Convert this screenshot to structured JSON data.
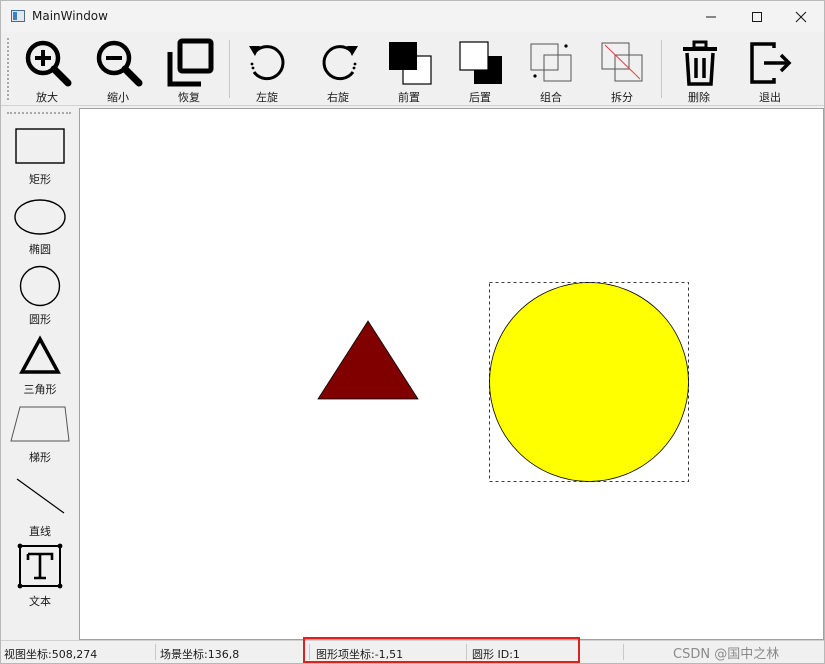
{
  "window": {
    "title": "MainWindow"
  },
  "toolbar": {
    "items": [
      {
        "label": "放大"
      },
      {
        "label": "缩小"
      },
      {
        "label": "恢复"
      },
      {
        "label": "左旋"
      },
      {
        "label": "右旋"
      },
      {
        "label": "前置"
      },
      {
        "label": "后置"
      },
      {
        "label": "组合"
      },
      {
        "label": "拆分"
      },
      {
        "label": "删除"
      },
      {
        "label": "退出"
      }
    ]
  },
  "sidebar": {
    "items": [
      {
        "label": "矩形"
      },
      {
        "label": "椭圆"
      },
      {
        "label": "圆形"
      },
      {
        "label": "三角形"
      },
      {
        "label": "梯形"
      },
      {
        "label": "直线"
      },
      {
        "label": "文本"
      }
    ]
  },
  "canvas": {
    "shapes": [
      {
        "type": "triangle",
        "fill": "#800000"
      },
      {
        "type": "circle",
        "fill": "#ffff00",
        "selected": true
      }
    ]
  },
  "status": {
    "view_coord": "视图坐标:508,274",
    "scene_coord": "场景坐标:136,8",
    "item_coord": "图形项坐标:-1,51",
    "item_info": "圆形 ID:1",
    "highlight_color": "#e02020"
  },
  "watermark": "CSDN @国中之林"
}
